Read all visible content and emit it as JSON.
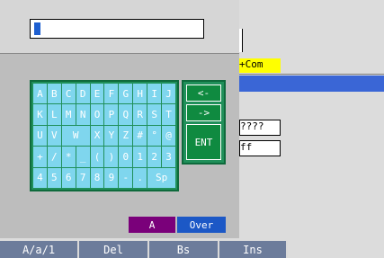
{
  "background_rows": [
    {
      "text": "+Com",
      "style": "yellow"
    },
    {
      "text": "",
      "style": "blue"
    },
    {
      "text": "????",
      "style": "white"
    },
    {
      "text": "ff",
      "style": "white"
    }
  ],
  "input": {
    "value": ""
  },
  "keyboard": {
    "rows": [
      [
        "A",
        "B",
        "C",
        "D",
        "E",
        "F",
        "G",
        "H",
        "I",
        "J"
      ],
      [
        "K",
        "L",
        "M",
        "N",
        "O",
        "P",
        "Q",
        "R",
        "S",
        "T"
      ],
      [
        "U",
        "V",
        "W",
        "X",
        "Y",
        "Z",
        "#",
        "°",
        "@"
      ],
      [
        "+",
        "/",
        "*",
        "_",
        "(",
        ")",
        "0",
        "1",
        "2",
        "3"
      ],
      [
        "4",
        "5",
        "6",
        "7",
        "8",
        "9",
        "-",
        ".",
        "Sp"
      ]
    ],
    "side": {
      "left": "<-",
      "right": "->",
      "enter": "ENT"
    }
  },
  "mode": {
    "case": "A",
    "over": "Over"
  },
  "function_bar": [
    "A/a/1",
    "Del",
    "Bs",
    "Ins"
  ]
}
